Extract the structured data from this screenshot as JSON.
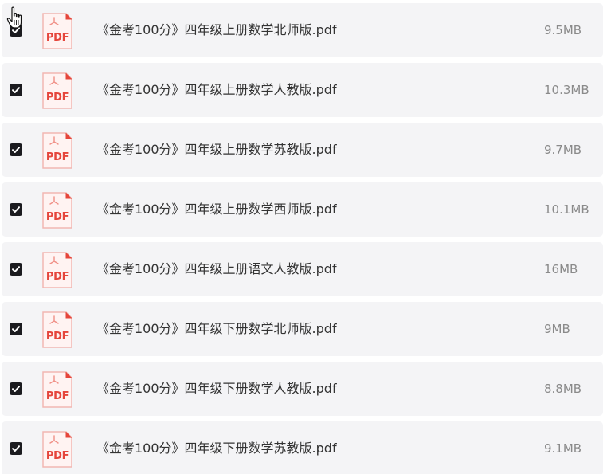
{
  "files": [
    {
      "name": "《金考100分》四年级上册数学北师版.pdf",
      "size": "9.5MB",
      "checked": true,
      "type_label": "PDF"
    },
    {
      "name": "《金考100分》四年级上册数学人教版.pdf",
      "size": "10.3MB",
      "checked": true,
      "type_label": "PDF"
    },
    {
      "name": "《金考100分》四年级上册数学苏教版.pdf",
      "size": "9.7MB",
      "checked": true,
      "type_label": "PDF"
    },
    {
      "name": "《金考100分》四年级上册数学西师版.pdf",
      "size": "10.1MB",
      "checked": true,
      "type_label": "PDF"
    },
    {
      "name": "《金考100分》四年级上册语文人教版.pdf",
      "size": "16MB",
      "checked": true,
      "type_label": "PDF"
    },
    {
      "name": "《金考100分》四年级下册数学北师版.pdf",
      "size": "9MB",
      "checked": true,
      "type_label": "PDF"
    },
    {
      "name": "《金考100分》四年级下册数学人教版.pdf",
      "size": "8.8MB",
      "checked": true,
      "type_label": "PDF"
    },
    {
      "name": "《金考100分》四年级下册数学苏教版.pdf",
      "size": "9.1MB",
      "checked": true,
      "type_label": "PDF"
    }
  ],
  "icons": {
    "file": "pdf-file-icon",
    "checkbox": "checkbox-checked-icon",
    "cursor": "hand-pointer-icon"
  },
  "colors": {
    "row_background": "#f4f4f6",
    "checkbox": "#1b1b1f",
    "pdf_red": "#e5453b",
    "filename_text": "#333333",
    "size_text": "#8a8a8a"
  }
}
